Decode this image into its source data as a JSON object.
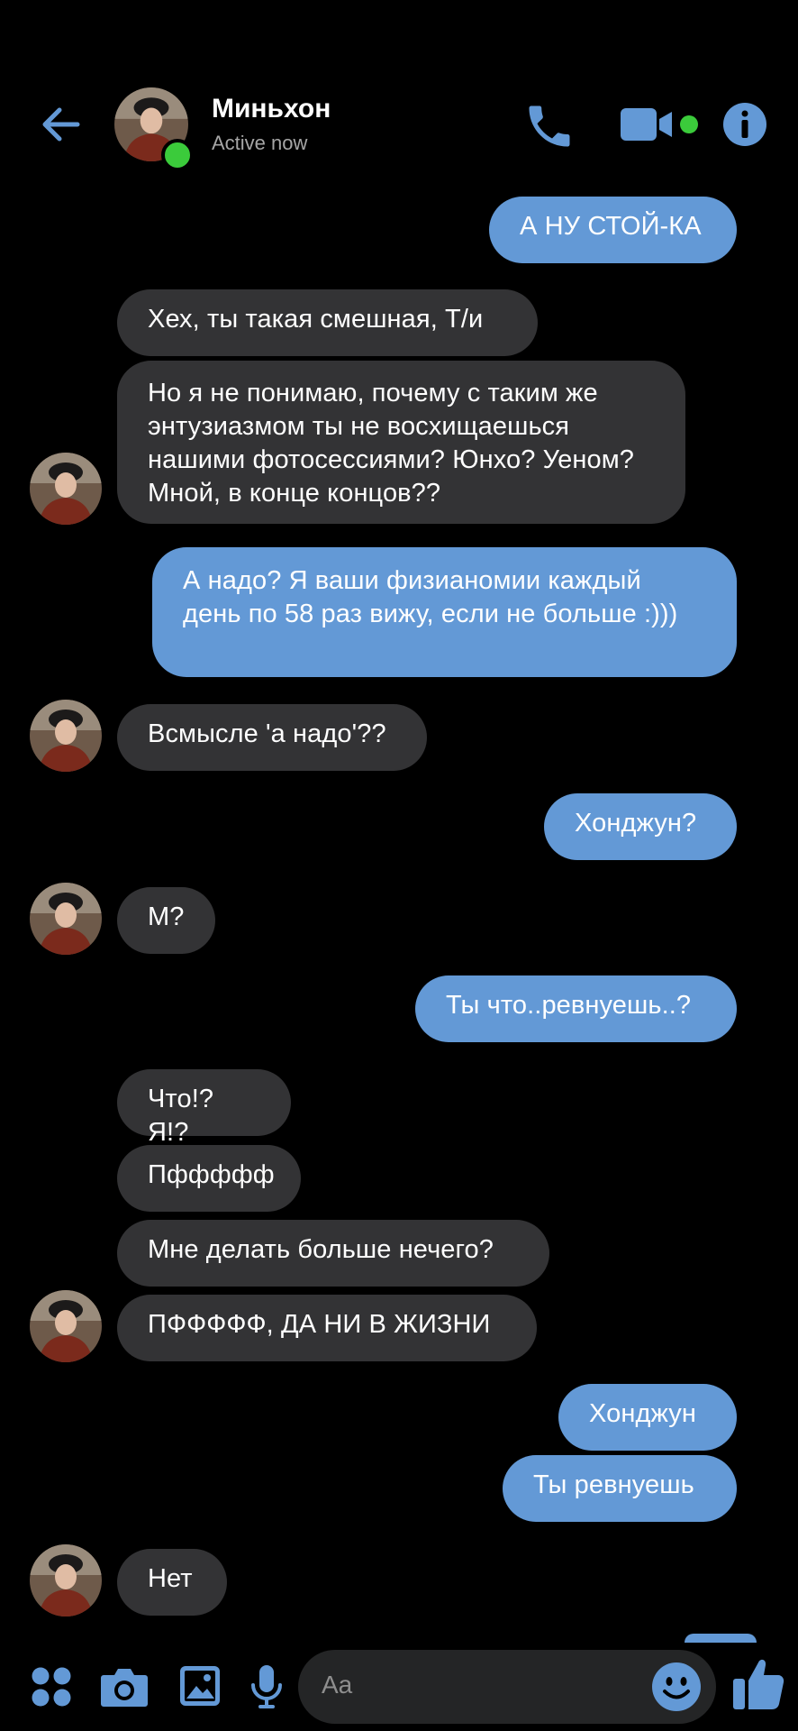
{
  "header": {
    "contact_name": "Миньхон",
    "status": "Active now"
  },
  "messages": [
    {
      "side": "out",
      "text": "А НУ СТОЙ-КА"
    },
    {
      "side": "in",
      "text": "Хех, ты такая смешная, Т/и"
    },
    {
      "side": "in",
      "text": "Но я не понимаю, почему с таким же энтузиазмом ты не восхищаешься нашими фотосессиями? Юнхо? Уеном? Мной, в конце концов??"
    },
    {
      "side": "out",
      "text": "А надо? Я ваши физианомии каждый день по 58 раз вижу, если не больше :)))"
    },
    {
      "side": "in",
      "text": "Всмысле 'а надо'??"
    },
    {
      "side": "out",
      "text": "Хонджун?"
    },
    {
      "side": "in",
      "text": "М?"
    },
    {
      "side": "out",
      "text": "Ты что..ревнуешь..?"
    },
    {
      "side": "in",
      "text": "Что!? Я!?"
    },
    {
      "side": "in",
      "text": "Пффффф"
    },
    {
      "side": "in",
      "text": "Мне делать больше нечего?"
    },
    {
      "side": "in",
      "text": "ПФФФФФ, ДА НИ В ЖИЗНИ"
    },
    {
      "side": "out",
      "text": "Хонджун"
    },
    {
      "side": "out",
      "text": "Ты ревнуешь"
    },
    {
      "side": "in",
      "text": "Нет"
    }
  ],
  "composer": {
    "placeholder": "Aa"
  },
  "colors": {
    "accent": "#6399d6",
    "incoming_bubble": "#333335",
    "online": "#3bcb3b",
    "background": "#000000"
  },
  "icons": [
    "back-arrow-icon",
    "phone-icon",
    "video-camera-icon",
    "info-icon",
    "apps-icon",
    "camera-icon",
    "gallery-icon",
    "microphone-icon",
    "emoji-icon",
    "thumbs-up-icon"
  ]
}
